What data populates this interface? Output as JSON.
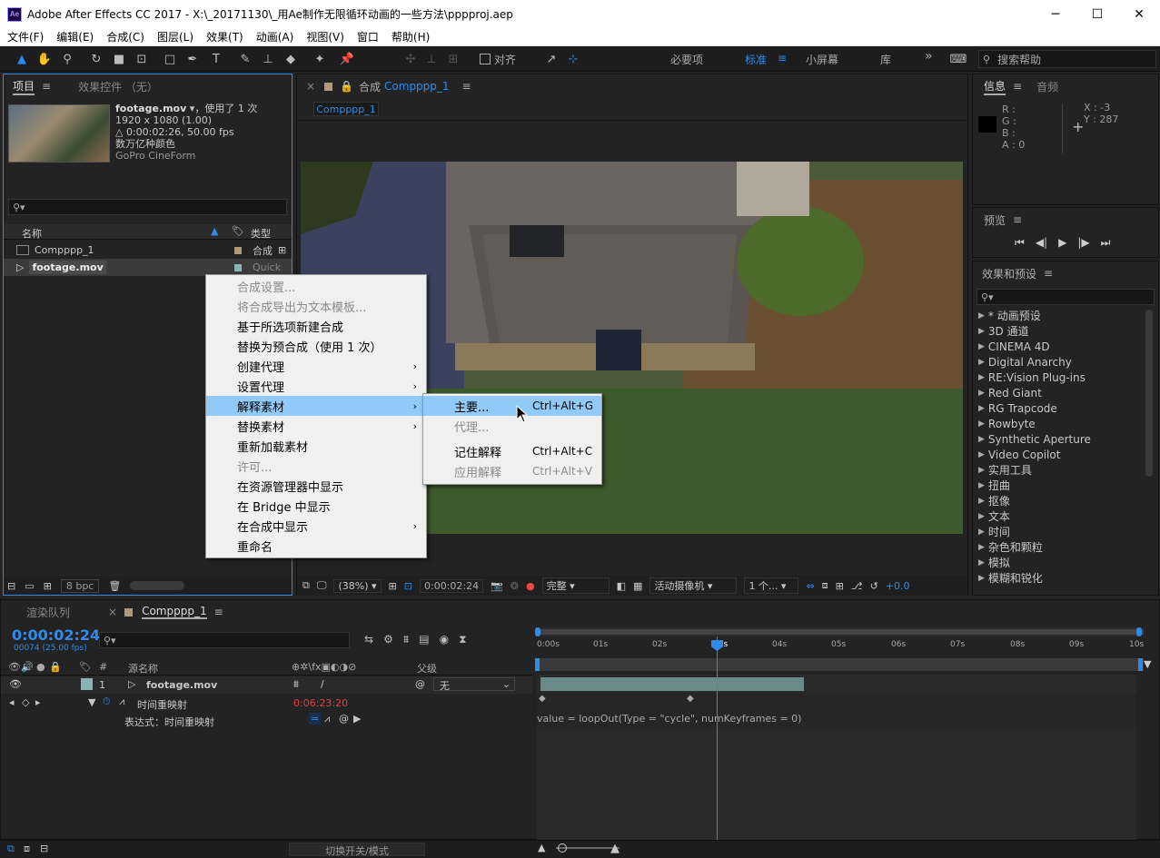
{
  "window": {
    "title": "Adobe After Effects CC 2017 - X:\\_20171130\\_用Ae制作无限循环动画的一些方法\\pppproj.aep",
    "app_icon": "Ae",
    "minimize": "─",
    "maximize": "☐",
    "close": "✕"
  },
  "menu": [
    "文件(F)",
    "编辑(E)",
    "合成(C)",
    "图层(L)",
    "效果(T)",
    "动画(A)",
    "视图(V)",
    "窗口",
    "帮助(H)"
  ],
  "toolbar": {
    "align_label": "对齐",
    "workspaces": [
      "必要项",
      "标准",
      "小屏幕",
      "库"
    ],
    "active_workspace": "标准",
    "search_help": "搜索帮助"
  },
  "project": {
    "tab_project": "项目",
    "tab_effects": "效果控件 （无）",
    "footage_name": "footage.mov",
    "used_text": "，使用了 1 次",
    "meta": [
      "1920 x 1080 (1.00)",
      "△ 0:00:02:26, 50.00 fps",
      "数万亿种颜色",
      "GoPro CineForm"
    ],
    "col_name": "名称",
    "col_type": "类型",
    "items": [
      {
        "name": "Compppp_1",
        "type": "合成"
      },
      {
        "name": "footage.mov",
        "type": "Quick"
      }
    ],
    "bpc": "8 bpc"
  },
  "context_menu": {
    "items": [
      {
        "label": "合成设置...",
        "disabled": true
      },
      {
        "label": "将合成导出为文本模板...",
        "disabled": true
      },
      {
        "label": "基于所选项新建合成"
      },
      {
        "label": "替换为预合成（使用 1 次）"
      },
      {
        "label": "创建代理",
        "submenu": true
      },
      {
        "label": "设置代理",
        "submenu": true
      },
      {
        "label": "解释素材",
        "submenu": true,
        "highlighted": true
      },
      {
        "label": "替换素材",
        "submenu": true
      },
      {
        "label": "重新加载素材"
      },
      {
        "label": "许可...",
        "disabled": true
      },
      {
        "label": "在资源管理器中显示"
      },
      {
        "label": "在 Bridge 中显示"
      },
      {
        "label": "在合成中显示",
        "submenu": true
      },
      {
        "label": "重命名"
      }
    ],
    "submenu": [
      {
        "label": "主要...",
        "shortcut": "Ctrl+Alt+G",
        "highlighted": true
      },
      {
        "label": "代理...",
        "disabled": true
      },
      {
        "label": "记住解释",
        "shortcut": "Ctrl+Alt+C"
      },
      {
        "label": "应用解释",
        "shortcut": "Ctrl+Alt+V",
        "disabled": true
      }
    ]
  },
  "comp": {
    "tab_prefix": "合成",
    "tab_name": "Compppp_1",
    "sub_tab": "Compppp_1",
    "zoom": "(38%)",
    "timecode": "0:00:02:24",
    "quality": "完整",
    "camera": "活动摄像机",
    "views": "1 个...",
    "exposure": "+0.0"
  },
  "info": {
    "tab_info": "信息",
    "tab_audio": "音频",
    "r": "R :",
    "g": "G :",
    "b": "B :",
    "a": "A : 0",
    "x": "X : -3",
    "y": "Y : 287"
  },
  "preview": {
    "title": "预览"
  },
  "effects": {
    "title": "效果和预设",
    "items": [
      "* 动画预设",
      "3D 通道",
      "CINEMA 4D",
      "Digital Anarchy",
      "RE:Vision Plug-ins",
      "Red Giant",
      "RG Trapcode",
      "Rowbyte",
      "Synthetic Aperture",
      "Video Copilot",
      "实用工具",
      "扭曲",
      "抠像",
      "文本",
      "时间",
      "杂色和颗粒",
      "模拟",
      "模糊和锐化"
    ]
  },
  "timeline": {
    "tab_render": "渲染队列",
    "tab_comp": "Compppp_1",
    "timecode": "0:00:02:24",
    "frames": "00074 (25.00 fps)",
    "col_source": "源名称",
    "col_parent": "父级",
    "layer_num": "1",
    "layer_name": "footage.mov",
    "parent_value": "无",
    "prop_name": "时间重映射",
    "prop_value": "0:06:23:20",
    "expr_label": "表达式：时间重映射",
    "expression": "value = loopOut(Type = \"cycle\", numKeyframes = 0)",
    "ruler": [
      "0:00s",
      "01s",
      "02s",
      "03s",
      "04s",
      "05s",
      "06s",
      "07s",
      "08s",
      "09s",
      "10s"
    ],
    "switch_label": "切换开关/模式"
  },
  "colors": {
    "accent": "#2d8ceb",
    "highlight": "#91c9f7",
    "layer_label": "#8ab3b3"
  }
}
